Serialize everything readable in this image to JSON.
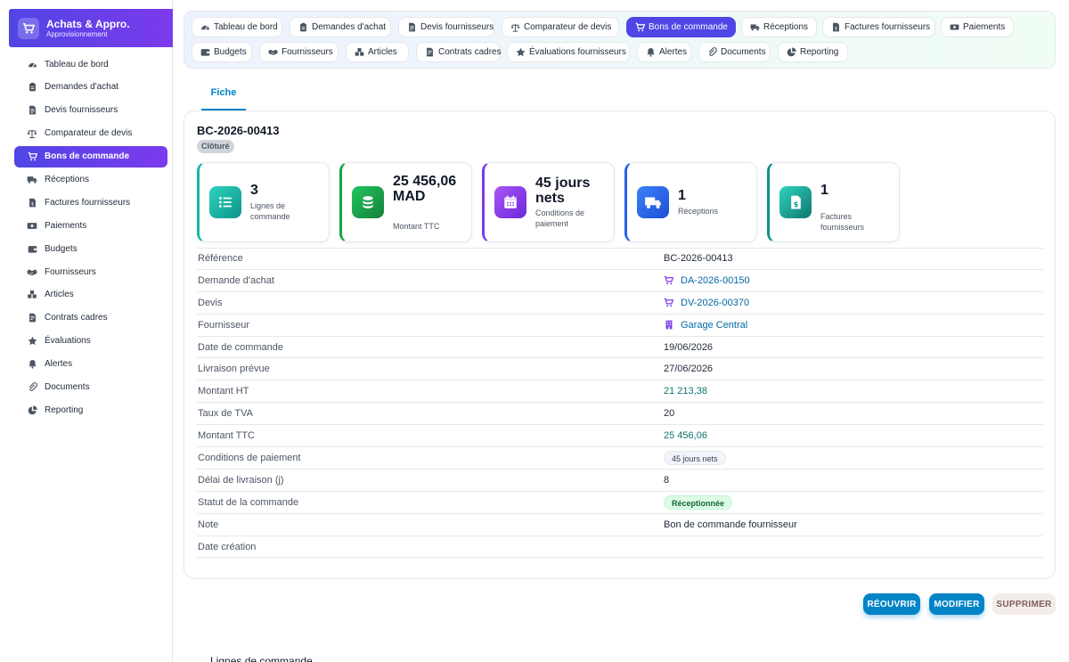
{
  "brand": {
    "title": "Achats & Appro.",
    "subtitle": "Approvisionnement"
  },
  "sidebar": {
    "items": [
      {
        "label": "Tableau de bord",
        "icon": "gauge-icon"
      },
      {
        "label": "Demandes d'achat",
        "icon": "clipboard-icon"
      },
      {
        "label": "Devis fournisseurs",
        "icon": "document-icon"
      },
      {
        "label": "Comparateur de devis",
        "icon": "scale-icon"
      },
      {
        "label": "Bons de commande",
        "icon": "cart-icon",
        "active": true
      },
      {
        "label": "Réceptions",
        "icon": "truck-icon"
      },
      {
        "label": "Factures fournisseurs",
        "icon": "invoice-icon"
      },
      {
        "label": "Paiements",
        "icon": "money-icon"
      },
      {
        "label": "Budgets",
        "icon": "wallet-icon"
      },
      {
        "label": "Fournisseurs",
        "icon": "handshake-icon"
      },
      {
        "label": "Articles",
        "icon": "boxes-icon"
      },
      {
        "label": "Contrats cadres",
        "icon": "contract-icon"
      },
      {
        "label": "Évaluations",
        "icon": "star-icon"
      },
      {
        "label": "Alertes",
        "icon": "bell-icon"
      },
      {
        "label": "Documents",
        "icon": "paperclip-icon"
      },
      {
        "label": "Reporting",
        "icon": "pie-icon"
      }
    ]
  },
  "topnav": {
    "row1": [
      {
        "label": "Tableau de bord",
        "icon": "gauge-icon"
      },
      {
        "label": "Demandes d'achat",
        "icon": "clipboard-icon"
      },
      {
        "label": "Devis fournisseurs",
        "icon": "document-icon"
      },
      {
        "label": "Comparateur de devis",
        "icon": "scale-icon"
      },
      {
        "label": "Bons de commande",
        "icon": "cart-icon",
        "active": true
      },
      {
        "label": "Réceptions",
        "icon": "truck-icon"
      },
      {
        "label": "Factures fournisseurs",
        "icon": "invoice-icon"
      },
      {
        "label": "Paiements",
        "icon": "money-icon"
      }
    ],
    "row2": [
      {
        "label": "Budgets",
        "icon": "wallet-icon"
      },
      {
        "label": "Fournisseurs",
        "icon": "handshake-icon"
      },
      {
        "label": "Articles",
        "icon": "boxes-icon"
      },
      {
        "label": "Contrats cadres",
        "icon": "contract-icon"
      },
      {
        "label": "Évaluations fournisseurs",
        "icon": "star-icon"
      },
      {
        "label": "Alertes",
        "icon": "bell-icon"
      },
      {
        "label": "Documents",
        "icon": "paperclip-icon"
      },
      {
        "label": "Reporting",
        "icon": "pie-icon"
      }
    ]
  },
  "tab": {
    "label": "Fiche"
  },
  "record": {
    "title": "BC-2026-00413",
    "status": "Clôturé",
    "stats": [
      {
        "value": "3",
        "label": "Lignes de commande",
        "color": "#14b8a6",
        "icon": "list-icon"
      },
      {
        "value": "25 456,06 MAD",
        "label": "Montant TTC",
        "color": "#16a34a",
        "icon": "coins-icon"
      },
      {
        "value": "45 jours nets",
        "label": "Conditions de paiement",
        "color": "#7c3aed",
        "icon": "calendar-icon"
      },
      {
        "value": "1",
        "label": "Réceptions",
        "color": "#2563eb",
        "icon": "truck-icon"
      },
      {
        "value": "1",
        "label": "Factures fournisseurs",
        "color": "#0d9488",
        "icon": "invoice-icon"
      }
    ],
    "fields": [
      {
        "label": "Référence",
        "value": "BC-2026-00413"
      },
      {
        "label": "Demande d'achat",
        "value": "DA-2026-00150",
        "type": "link",
        "icon": "cart-icon"
      },
      {
        "label": "Devis",
        "value": "DV-2026-00370",
        "type": "link",
        "icon": "cart-icon"
      },
      {
        "label": "Fournisseur",
        "value": "Garage Central",
        "type": "link",
        "icon": "building-icon"
      },
      {
        "label": "Date de commande",
        "value": "19/06/2026"
      },
      {
        "label": "Livraison prévue",
        "value": "27/06/2026"
      },
      {
        "label": "Montant HT",
        "value": "21 213,38",
        "type": "money"
      },
      {
        "label": "Taux de TVA",
        "value": "20"
      },
      {
        "label": "Montant TTC",
        "value": "25 456,06",
        "type": "money"
      },
      {
        "label": "Conditions de paiement",
        "value": "45 jours nets",
        "type": "chip-grey"
      },
      {
        "label": "Délai de livraison (j)",
        "value": "8"
      },
      {
        "label": "Statut de la commande",
        "value": "Réceptionnée",
        "type": "chip-green"
      },
      {
        "label": "Note",
        "value": "Bon de commande fournisseur"
      },
      {
        "label": "Date création",
        "value": ""
      }
    ]
  },
  "actions": {
    "reopen": "RÉOUVRIR",
    "edit": "MODIFIER",
    "delete": "SUPPRIMER"
  },
  "footer": {
    "section_title": "Lignes de commande"
  }
}
